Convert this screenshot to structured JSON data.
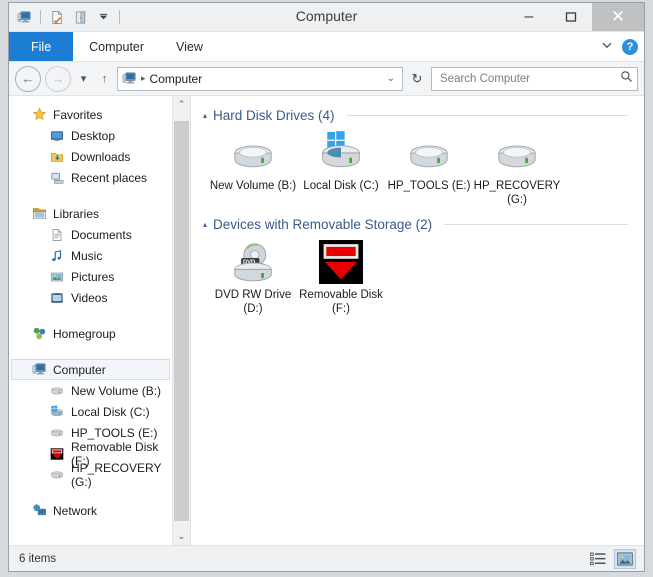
{
  "window": {
    "title": "Computer",
    "minimize_label": "‒",
    "maximize_label": "☐",
    "close_label": "✕",
    "quick_access": [
      {
        "name": "computer-icon",
        "label": "Computer"
      },
      {
        "name": "properties-icon",
        "label": "Properties"
      },
      {
        "name": "open-pane-icon",
        "label": "Open"
      },
      {
        "name": "chevron-down-icon",
        "label": "Customize Quick Access Toolbar"
      }
    ]
  },
  "ribbon": {
    "tabs": [
      {
        "label": "File",
        "selected": true
      },
      {
        "label": "Computer",
        "selected": false
      },
      {
        "label": "View",
        "selected": false
      }
    ],
    "expand_label": "⌄",
    "help_label": "?"
  },
  "address_bar": {
    "back_label": "←",
    "forward_label": "→",
    "recent_label": "▾",
    "up_label": "↑",
    "crumb_separator": "▸",
    "crumbs": [
      "Computer"
    ],
    "dropdown_label": "⌄",
    "refresh_label": "↻"
  },
  "search": {
    "placeholder": "Search Computer",
    "value": "",
    "icon": "search-icon"
  },
  "sidebar": {
    "scroll_up_label": "⌃",
    "scroll_down_label": "⌄",
    "groups": [
      {
        "header": {
          "label": "Favorites",
          "icon": "star-icon"
        },
        "items": [
          {
            "label": "Desktop",
            "icon": "desktop-icon"
          },
          {
            "label": "Downloads",
            "icon": "downloads-icon"
          },
          {
            "label": "Recent places",
            "icon": "recent-places-icon"
          }
        ]
      },
      {
        "header": {
          "label": "Libraries",
          "icon": "libraries-icon"
        },
        "items": [
          {
            "label": "Documents",
            "icon": "documents-icon"
          },
          {
            "label": "Music",
            "icon": "music-icon"
          },
          {
            "label": "Pictures",
            "icon": "pictures-icon"
          },
          {
            "label": "Videos",
            "icon": "videos-icon"
          }
        ]
      },
      {
        "header": {
          "label": "Homegroup",
          "icon": "homegroup-icon"
        },
        "items": []
      },
      {
        "header": {
          "label": "Computer",
          "icon": "computer-icon",
          "selected": true
        },
        "items": [
          {
            "label": "New Volume (B:)",
            "icon": "drive-icon"
          },
          {
            "label": "Local Disk (C:)",
            "icon": "windows-drive-icon"
          },
          {
            "label": "HP_TOOLS (E:)",
            "icon": "drive-icon"
          },
          {
            "label": "Removable Disk (F:)",
            "icon": "removable-red-icon"
          },
          {
            "label": "HP_RECOVERY (G:)",
            "icon": "drive-icon"
          }
        ]
      },
      {
        "header": {
          "label": "Network",
          "icon": "network-icon"
        },
        "items": []
      }
    ]
  },
  "main": {
    "groups": [
      {
        "title": "Hard Disk Drives (4)",
        "collapse_label": "▴",
        "items": [
          {
            "label": "New Volume (B:)",
            "icon": "hard-drive-icon"
          },
          {
            "label": "Local Disk (C:)",
            "icon": "windows-system-drive-icon"
          },
          {
            "label": "HP_TOOLS (E:)",
            "icon": "hard-drive-icon"
          },
          {
            "label": "HP_RECOVERY (G:)",
            "icon": "hard-drive-icon"
          }
        ]
      },
      {
        "title": "Devices with Removable Storage (2)",
        "collapse_label": "▴",
        "items": [
          {
            "label": "DVD RW Drive (D:)",
            "icon": "dvd-drive-icon"
          },
          {
            "label": "Removable Disk (F:)",
            "icon": "removable-red-icon"
          }
        ]
      }
    ]
  },
  "status_bar": {
    "item_count": "6 items",
    "views": [
      {
        "name": "details-view-button",
        "active": false
      },
      {
        "name": "large-icons-view-button",
        "active": true
      }
    ]
  },
  "colors": {
    "file_tab_blue": "#1b7dd4",
    "group_header_blue": "#3a5a8c",
    "title_bar": "#eff0f2",
    "selection": "#f2f6fb",
    "accent_red": "#e60000"
  }
}
